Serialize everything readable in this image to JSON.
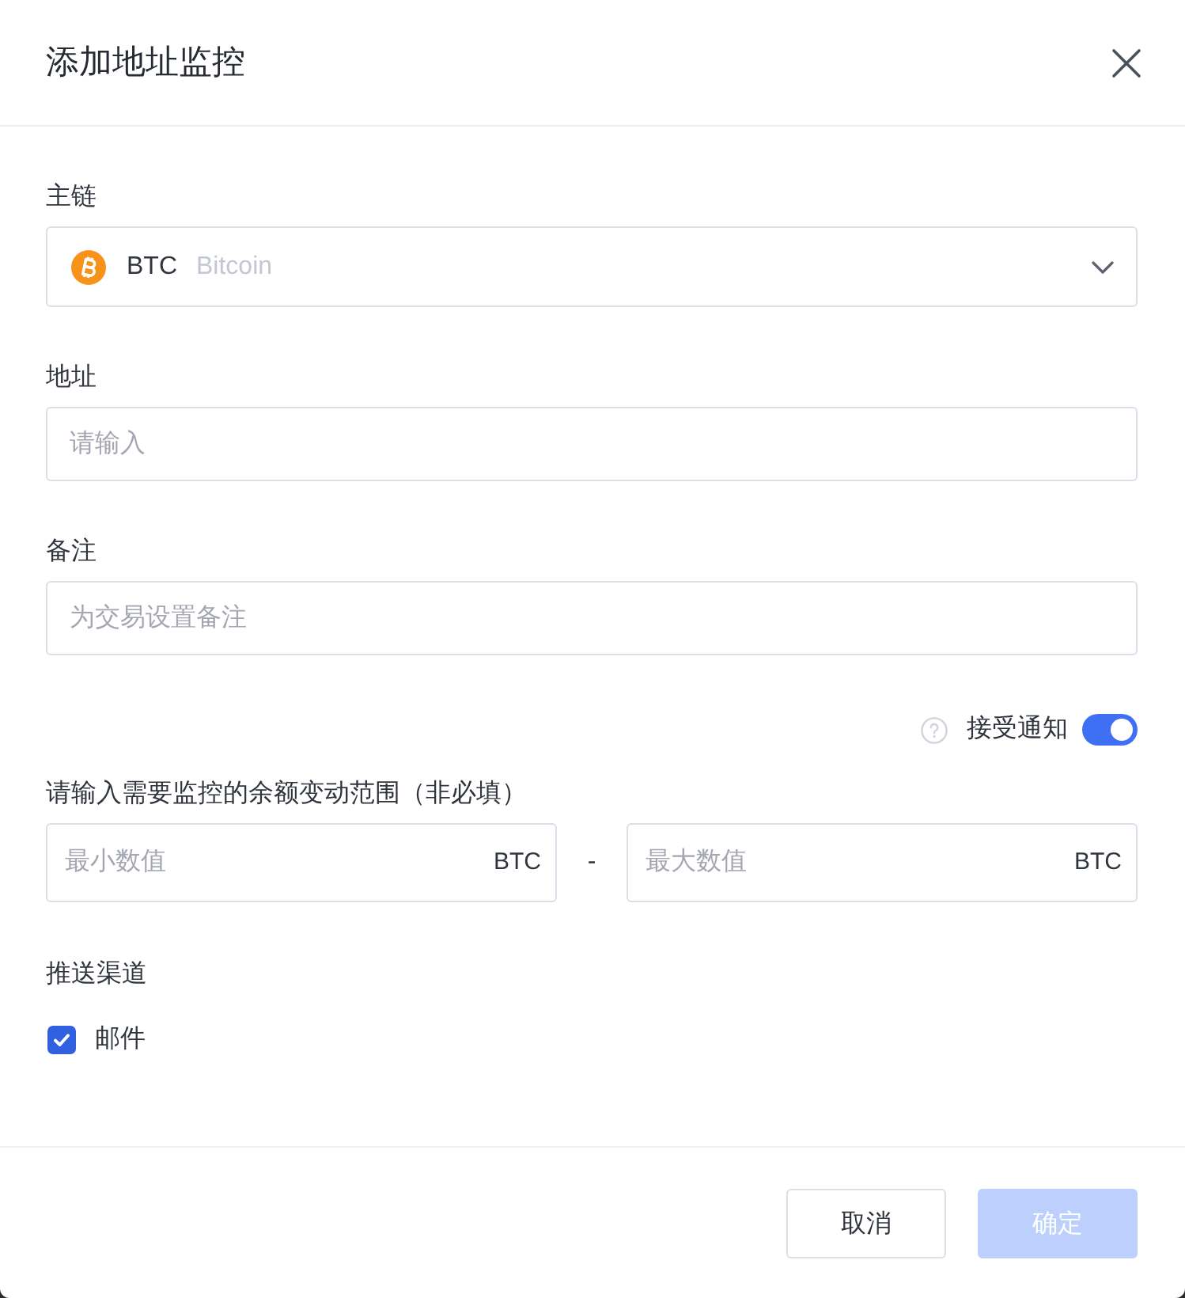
{
  "dialog": {
    "title": "添加地址监控"
  },
  "fields": [
    {
      "kind": "select",
      "label": "主链",
      "symbol": "BTC",
      "name": "Bitcoin"
    },
    {
      "kind": "input",
      "label": "地址",
      "placeholder": "请输入"
    },
    {
      "kind": "input",
      "label": "备注",
      "placeholder": "为交易设置备注"
    }
  ],
  "notify": {
    "label": "接受通知",
    "on": true
  },
  "range": {
    "label": "请输入需要监控的余额变动范围（非必填）",
    "separator": "-",
    "min": {
      "placeholder": "最小数值",
      "suffix": "BTC"
    },
    "max": {
      "placeholder": "最大数值",
      "suffix": "BTC"
    }
  },
  "channels": {
    "label": "推送渠道",
    "options": [
      {
        "label": "邮件",
        "checked": true
      }
    ]
  },
  "buttons": [
    {
      "label": "取消",
      "kind": "secondary",
      "disabled": false
    },
    {
      "label": "确定",
      "kind": "primary",
      "disabled": true
    }
  ]
}
